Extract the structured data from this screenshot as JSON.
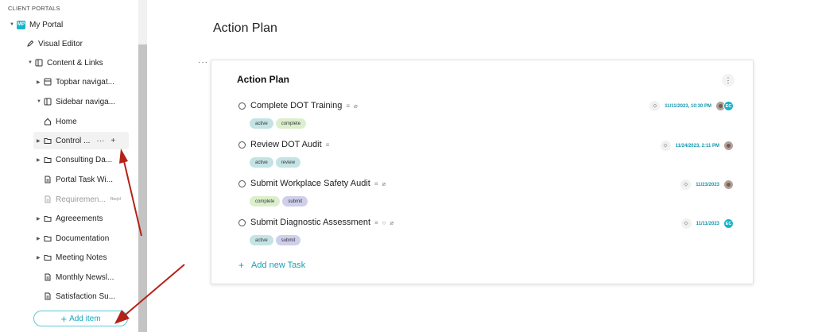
{
  "sidebar": {
    "section_title": "CLIENT PORTALS",
    "portal": {
      "badge": "MP",
      "label": "My Portal"
    },
    "items": [
      {
        "label": "Visual Editor",
        "icon": "pencil-icon"
      },
      {
        "label": "Content & Links",
        "icon": "layout-icon"
      },
      {
        "label": "Topbar navigat...",
        "icon": "topbar-icon"
      },
      {
        "label": "Sidebar naviga...",
        "icon": "sidebar-icon"
      },
      {
        "label": "Home",
        "icon": "home-icon"
      },
      {
        "label": "Control ...",
        "icon": "folder-icon"
      },
      {
        "label": "Consulting Da...",
        "icon": "folder-icon"
      },
      {
        "label": "Portal Task Wi...",
        "icon": "page-icon"
      },
      {
        "label": "Requiremen...",
        "icon": "page-icon",
        "tag": "Req'd"
      },
      {
        "label": "Agreeements",
        "icon": "folder-icon"
      },
      {
        "label": "Documentation",
        "icon": "folder-icon"
      },
      {
        "label": "Meeting Notes",
        "icon": "folder-icon"
      },
      {
        "label": "Monthly Newsl...",
        "icon": "page-icon"
      },
      {
        "label": "Satisfaction Su...",
        "icon": "page-icon"
      }
    ],
    "hover_actions": {
      "more": "···",
      "add": "+"
    },
    "add_item_label": "Add item"
  },
  "main": {
    "page_title": "Action Plan",
    "card": {
      "title": "Action Plan",
      "tasks": [
        {
          "title": "Complete DOT Training",
          "tags": [
            "active",
            "complete"
          ],
          "date": "11/11/2023, 10:30 PM",
          "assignees": [
            "photo",
            "EC"
          ]
        },
        {
          "title": "Review DOT Audit",
          "tags": [
            "active",
            "review"
          ],
          "date": "11/24/2023, 2:11 PM",
          "assignees": [
            "photo"
          ]
        },
        {
          "title": "Submit Workplace Safety Audit",
          "tags": [
            "complete",
            "submit"
          ],
          "date": "11/23/2023",
          "assignees": [
            "photo"
          ]
        },
        {
          "title": "Submit Diagnostic Assessment",
          "tags": [
            "active",
            "submit"
          ],
          "date": "11/11/2023",
          "assignees": [
            "EC"
          ]
        }
      ],
      "add_task_label": "Add new Task"
    }
  },
  "colors": {
    "accent": "#18b3c9",
    "tag_active": "#c4e3e4",
    "tag_complete": "#dcefcd",
    "tag_review": "#c4e3e4",
    "tag_submit": "#cfcfec",
    "annotation_arrow": "#b42318"
  }
}
